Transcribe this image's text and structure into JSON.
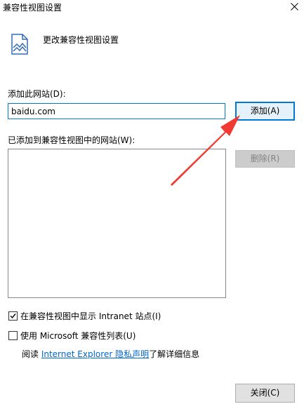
{
  "window": {
    "title": "兼容性视图设置",
    "close_glyph": "✕"
  },
  "header": {
    "icon": "compat-page-icon",
    "text": "更改兼容性视图设置"
  },
  "add_site": {
    "label": "添加此网站(D):",
    "input_value": "baidu.com",
    "add_button": "添加(A)"
  },
  "added_sites": {
    "label": "已添加到兼容性视图中的网站(W):",
    "items": [],
    "remove_button": "删除(R)"
  },
  "options": {
    "intranet": {
      "label": "在兼容性视图中显示 Intranet 站点(I)",
      "checked": true
    },
    "ms_list": {
      "label": "使用 Microsoft 兼容性列表(U)",
      "checked": false
    }
  },
  "privacy": {
    "prefix": "阅读 ",
    "link": "Internet Explorer 隐私声明",
    "suffix": "了解详细信息"
  },
  "footer": {
    "close_button": "关闭(C)"
  },
  "colors": {
    "accent": "#0078d7",
    "link": "#0066cc",
    "annotation_arrow": "#f03a32"
  }
}
